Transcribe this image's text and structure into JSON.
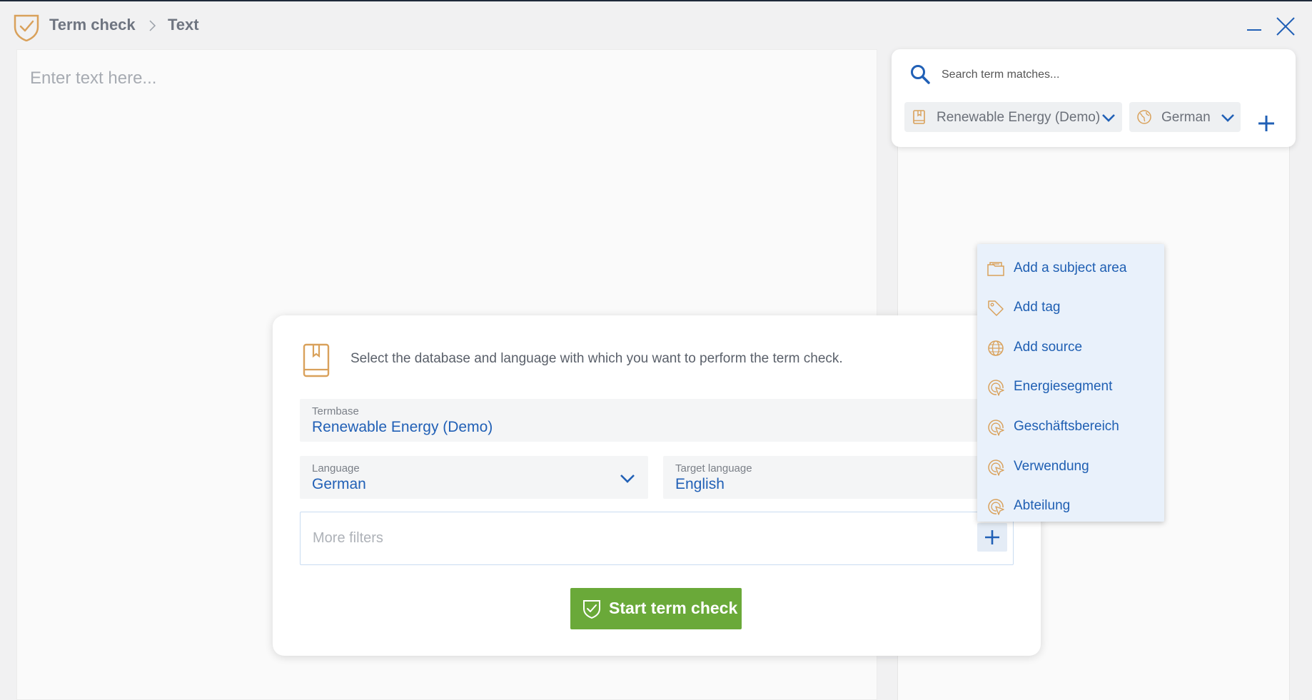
{
  "header": {
    "breadcrumb": [
      "Term check",
      "Text"
    ]
  },
  "editor": {
    "placeholder": "Enter text here..."
  },
  "search_panel": {
    "placeholder": "Search term matches...",
    "termbase_chip": "Renewable Energy (Demo)",
    "language_chip": "German"
  },
  "modal": {
    "instruction": "Select the database and language with which you want to perform the term check.",
    "termbase": {
      "label": "Termbase",
      "value": "Renewable Energy (Demo)"
    },
    "language": {
      "label": "Language",
      "value": "German"
    },
    "target_language": {
      "label": "Target language",
      "value": "English"
    },
    "filters_placeholder": "More filters",
    "start_button": "Start term check"
  },
  "menu": {
    "items": [
      {
        "label": "Add a subject area",
        "icon": "folder-icon"
      },
      {
        "label": "Add tag",
        "icon": "tag-icon"
      },
      {
        "label": "Add source",
        "icon": "globe-icon"
      },
      {
        "label": "Energiesegment",
        "icon": "attribute-icon"
      },
      {
        "label": "Geschäftsbereich",
        "icon": "attribute-icon"
      },
      {
        "label": "Verwendung",
        "icon": "attribute-icon"
      },
      {
        "label": "Abteilung",
        "icon": "attribute-icon"
      }
    ]
  },
  "colors": {
    "accent_blue": "#2160b6",
    "brand_orange": "#d9a15b",
    "start_green": "#6aa939",
    "menu_bg": "#e9f1fb"
  }
}
